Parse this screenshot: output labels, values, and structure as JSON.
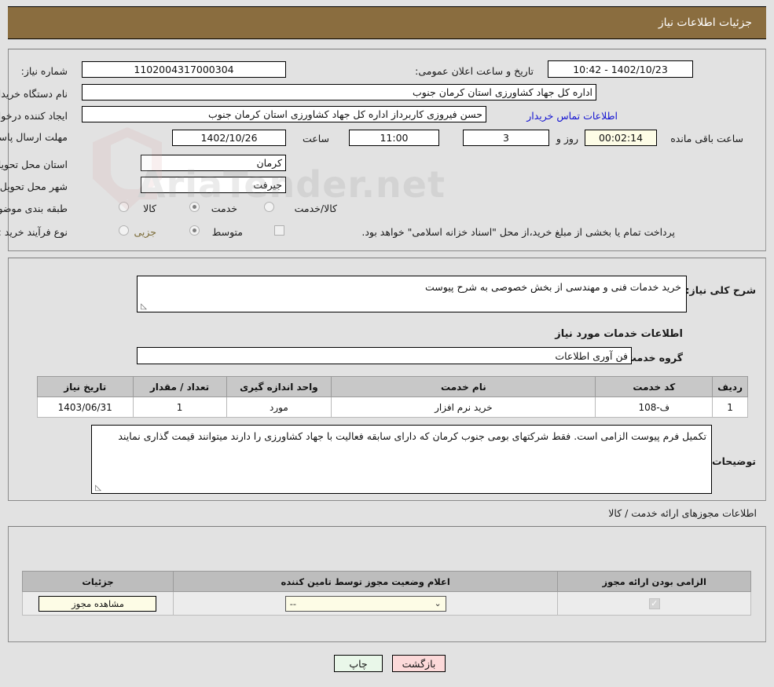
{
  "header": {
    "title": "جزئیات اطلاعات نیاز"
  },
  "top": {
    "need_number_label": "شماره نیاز:",
    "need_number_value": "1102004317000304",
    "public_announce_label": "تاریخ و ساعت اعلان عمومی:",
    "public_announce_value": "1402/10/23 - 10:42",
    "buyer_org_label": "نام دستگاه خریدار:",
    "buyer_org_value": "اداره کل جهاد کشاورزی استان کرمان   جنوب",
    "creator_label": "ایجاد کننده درخواست:",
    "creator_value": "حسن فیروزی کاربرداز اداره کل جهاد کشاورزی استان کرمان   جنوب",
    "creator_region_value": "استان کرمان   جنوب",
    "contact_link": "اطلاعات تماس خریدار",
    "deadline_label": "مهلت ارسال پاسخ: تا تاریخ:",
    "deadline_date": "1402/10/26",
    "time_label": "ساعت",
    "time_value": "11:00",
    "days_value": "3",
    "days_suffix": "روز و",
    "countdown_value": "00:02:14",
    "countdown_suffix": "ساعت باقی مانده",
    "province_label": "استان محل تحویل:",
    "province_value": "کرمان",
    "city_label": "شهر محل تحویل:",
    "city_value": "جیرفت",
    "category_label": "طبقه بندی موضوعی:",
    "category_options": [
      "کالا",
      "خدمت",
      "کالا/خدمت"
    ],
    "category_selected": "خدمت",
    "process_label": "نوع فرآیند خرید :",
    "process_options": [
      "جزیی",
      "متوسط"
    ],
    "process_selected": "متوسط",
    "treasury_checkbox_text": "پرداخت تمام یا بخشی از مبلغ خرید،از محل \"اسناد خزانه اسلامی\" خواهد بود.",
    "treasury_checked": false
  },
  "mid": {
    "general_desc_label": "شرح کلی نیاز:",
    "general_desc_value": "خرید خدمات فنی و مهندسی از بخش خصوصی به شرح پیوست",
    "services_heading": "اطلاعات خدمات مورد نیاز",
    "service_group_label": "گروه خدمت:",
    "service_group_value": "فن آوری اطلاعات",
    "table": {
      "columns": [
        "ردیف",
        "کد خدمت",
        "نام خدمت",
        "واحد اندازه گیری",
        "تعداد / مقدار",
        "تاریخ نیاز"
      ],
      "rows": [
        {
          "row": "1",
          "code": "ف-108",
          "name": "خرید نرم افزار",
          "unit": "مورد",
          "qty": "1",
          "date": "1403/06/31"
        }
      ]
    },
    "buyer_notes_label": "توضیحات خریدار:",
    "buyer_notes_value": "تکمیل فرم پیوست الزامی است. فقط شرکتهای بومی جنوب کرمان که دارای سابقه فعالیت  با جهاد کشاورزی را دارند میتوانند قیمت گذاری نمایند"
  },
  "permits": {
    "section_title": "اطلاعات مجوزهای ارائه خدمت / کالا",
    "columns": [
      "الزامی بودن ارائه مجوز",
      "اعلام وضعیت مجوز توسط تامین کننده",
      "جزئیات"
    ],
    "rows": [
      {
        "required_checked": true,
        "status_value": "--",
        "detail_button": "مشاهده مجوز"
      }
    ]
  },
  "footer": {
    "print_label": "چاپ",
    "back_label": "بازگشت"
  },
  "watermark": {
    "text": "AriaTender.net"
  },
  "colors": {
    "header_bg": "#8a6d3f",
    "page_bg": "#e2e2e2",
    "link": "#1414d2",
    "olive": "#7a6a35",
    "cream": "#fdfce6",
    "print_btn": "#e9f7e9",
    "back_btn": "#fcd9d9"
  }
}
